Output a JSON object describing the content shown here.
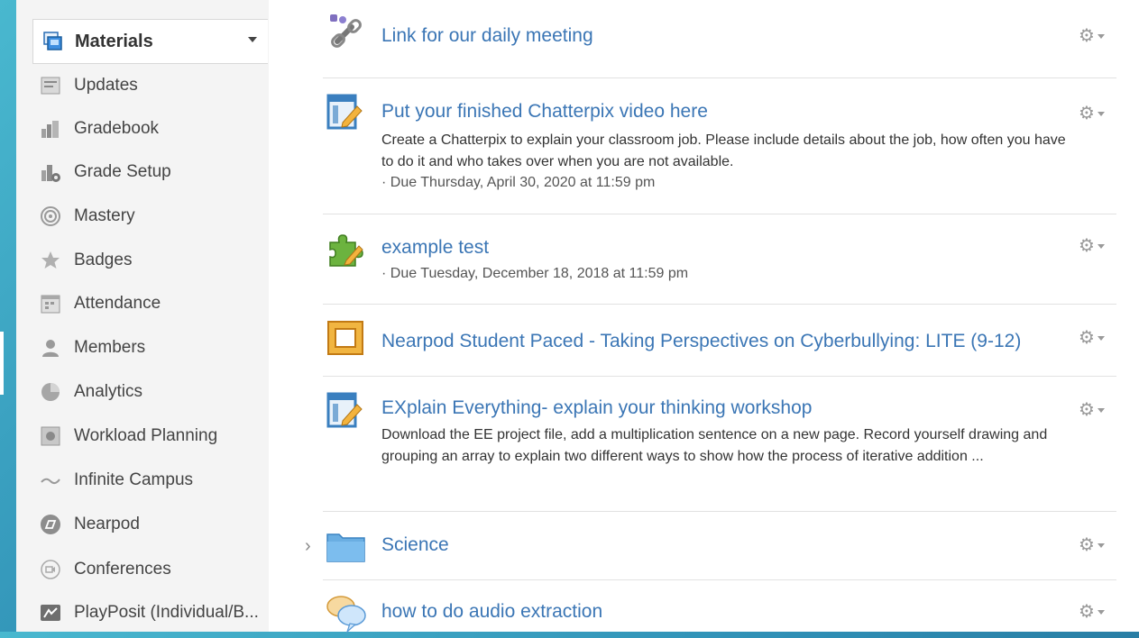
{
  "sidebar": {
    "active": {
      "label": "Materials",
      "icon": "materials-icon"
    },
    "items": [
      {
        "label": "Updates",
        "icon": "updates-icon"
      },
      {
        "label": "Gradebook",
        "icon": "gradebook-icon"
      },
      {
        "label": "Grade Setup",
        "icon": "grade-setup-icon"
      },
      {
        "label": "Mastery",
        "icon": "mastery-icon"
      },
      {
        "label": "Badges",
        "icon": "badge-icon"
      },
      {
        "label": "Attendance",
        "icon": "attendance-icon"
      },
      {
        "label": "Members",
        "icon": "members-icon"
      },
      {
        "label": "Analytics",
        "icon": "analytics-icon"
      },
      {
        "label": "Workload Planning",
        "icon": "workload-icon"
      },
      {
        "label": "Infinite Campus",
        "icon": "infinite-campus-icon"
      },
      {
        "label": "Nearpod",
        "icon": "nearpod-icon"
      },
      {
        "label": "Conferences",
        "icon": "conferences-icon"
      },
      {
        "label": "PlayPosit (Individual/B...",
        "icon": "playposit-icon"
      }
    ]
  },
  "materials": [
    {
      "title": "Link for our daily meeting",
      "icon": "link-icon"
    },
    {
      "title": "Put your finished Chatterpix video here",
      "icon": "assignment-icon",
      "desc": "Create a Chatterpix to explain your classroom job. Please include details about the job, how often you have to do it and who takes over when you are not available.",
      "due": "· Due Thursday, April 30, 2020 at 11:59 pm"
    },
    {
      "title": "example test",
      "icon": "puzzle-icon",
      "due": "· Due Tuesday, December 18, 2018 at 11:59 pm"
    },
    {
      "title": "Nearpod Student Paced - Taking Perspectives on Cyberbullying: LITE (9-12)",
      "icon": "nearpod-frame-icon"
    },
    {
      "title": "EXplain Everything- explain your thinking workshop",
      "icon": "assignment-icon",
      "desc": "Download the EE project file, add a multiplication sentence on a new page. Record yourself drawing and grouping an array to explain two different ways to show how the process of iterative addition ..."
    },
    {
      "title": "Science",
      "icon": "folder-icon"
    },
    {
      "title": "how to do audio extraction",
      "icon": "discussion-icon"
    }
  ],
  "gear_glyph": "⚙",
  "expander_glyph": "›",
  "colors": {
    "link": "#3b76b5",
    "background_gradient_start": "#49b8cf",
    "background_gradient_end": "#1e5f86"
  }
}
